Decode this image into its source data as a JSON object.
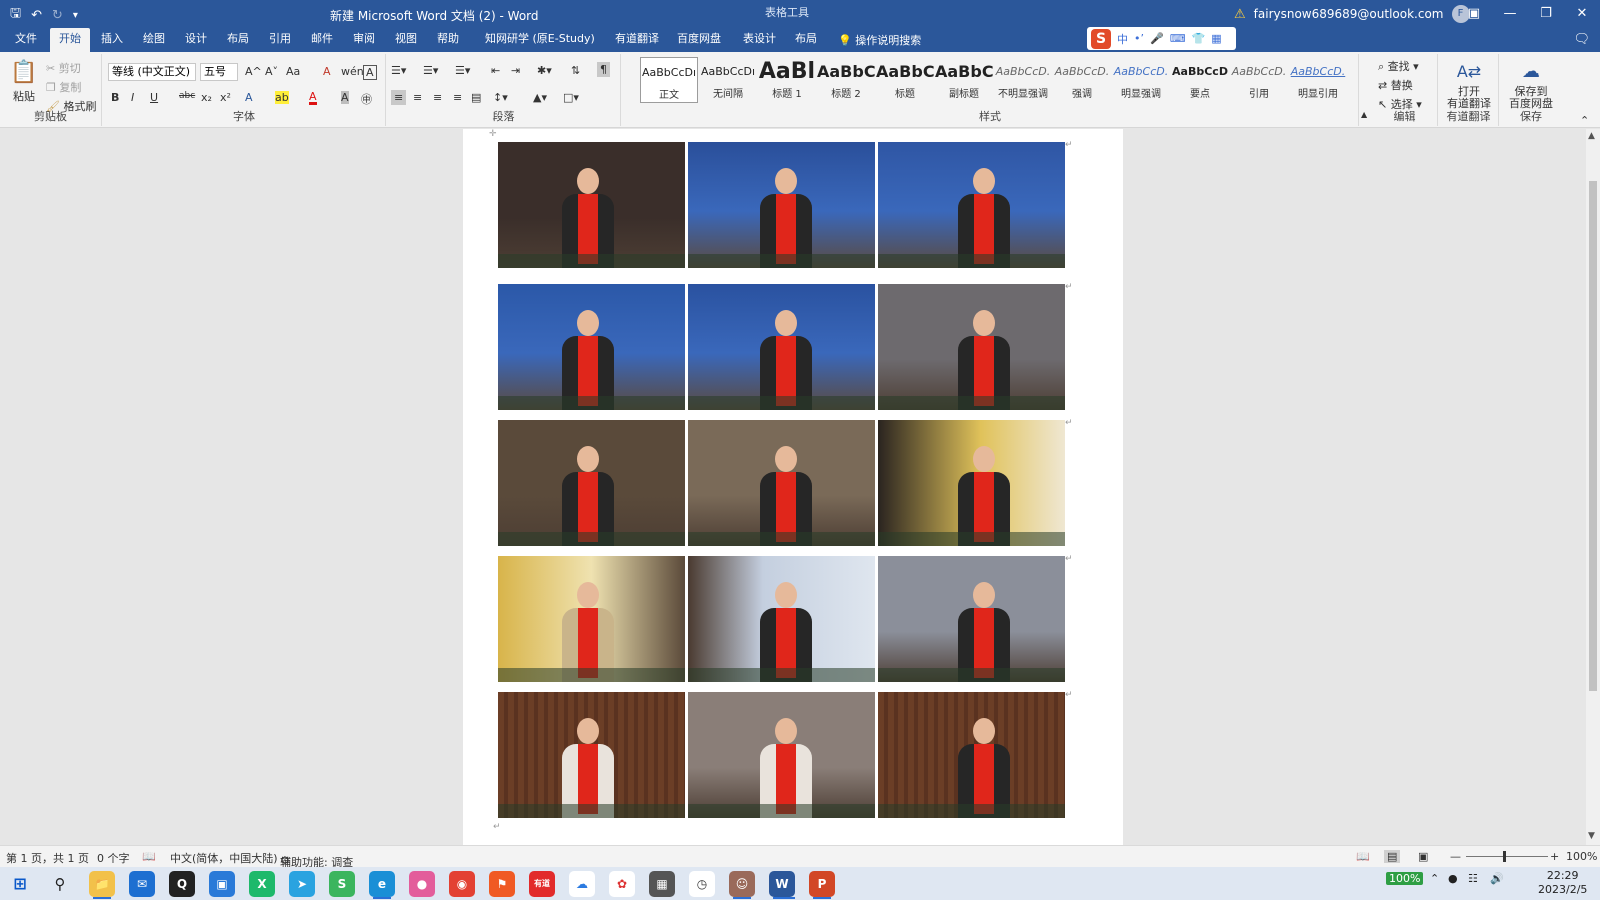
{
  "titlebar": {
    "title": "新建 Microsoft Word 文档 (2)  -  Word",
    "context_tab_group": "表格工具",
    "account": "fairysnow689689@outlook.com",
    "avatar_letter": "F",
    "qat_icons": [
      "save-icon",
      "undo-icon",
      "redo-icon",
      "customize-icon"
    ]
  },
  "tabs": [
    "文件",
    "开始",
    "插入",
    "绘图",
    "设计",
    "布局",
    "引用",
    "邮件",
    "审阅",
    "视图",
    "帮助",
    "知网研学 (原E-Study)",
    "有道翻译",
    "百度网盘",
    "表设计",
    "布局"
  ],
  "active_tab": "开始",
  "tell_me": "操作说明搜索",
  "ime": {
    "mode": "中",
    "brand": "S"
  },
  "ribbon": {
    "clipboard": {
      "paste": "粘贴",
      "cut": "剪切",
      "copy": "复制",
      "format_painter": "格式刷",
      "label": "剪贴板"
    },
    "font": {
      "font_name": "等线 (中文正文)",
      "font_size": "五号",
      "label": "字体",
      "row1": [
        "A^",
        "A˅",
        "Aa",
        "A",
        "wén",
        "A"
      ],
      "row2": [
        "B",
        "I",
        "U",
        "abc",
        "x₂",
        "x²",
        "A",
        "ab",
        "A",
        "A",
        "㊥"
      ]
    },
    "paragraph": {
      "label": "段落"
    },
    "styles": {
      "label": "样式",
      "items": [
        {
          "preview": "AaBbCcDı",
          "name": "正文",
          "size": "11px"
        },
        {
          "preview": "AaBbCcDı",
          "name": "无间隔",
          "size": "11px"
        },
        {
          "preview": "AaBl",
          "name": "标题 1",
          "size": "22px"
        },
        {
          "preview": "AaBbC",
          "name": "标题 2",
          "size": "16px"
        },
        {
          "preview": "AaBbC",
          "name": "标题",
          "size": "16px"
        },
        {
          "preview": "AaBbC",
          "name": "副标题",
          "size": "16px"
        },
        {
          "preview": "AaBbCcD.",
          "name": "不明显强调",
          "size": "11px"
        },
        {
          "preview": "AaBbCcD.",
          "name": "强调",
          "size": "11px"
        },
        {
          "preview": "AaBbCcD.",
          "name": "明显强调",
          "size": "11px"
        },
        {
          "preview": "AaBbCcD",
          "name": "要点",
          "size": "11px"
        },
        {
          "preview": "AaBbCcD.",
          "name": "引用",
          "size": "11px"
        },
        {
          "preview": "AaBbCcD.",
          "name": "明显引用",
          "size": "11px"
        }
      ]
    },
    "editing": {
      "find": "查找",
      "replace": "替换",
      "select": "选择",
      "label": "编辑"
    },
    "youdao": {
      "button": "打开\n有道翻译",
      "label": "有道翻译"
    },
    "baidu": {
      "button": "保存到\n百度网盘",
      "label": "保存"
    }
  },
  "photos": [
    {
      "id": 1,
      "scene": "speaker-dark-room",
      "bg": "#3a2e2a",
      "accent": "#e0261b"
    },
    {
      "id": 2,
      "scene": "ccf-yocsef-backdrop",
      "bg": "#2a4f9a",
      "accent": "#e0261b"
    },
    {
      "id": 3,
      "scene": "ccf-yocsef-backdrop",
      "bg": "#2f56a4",
      "accent": "#e0261b"
    },
    {
      "id": 4,
      "scene": "woman-presenting",
      "bg": "#2b58a8",
      "accent": "#e0261b"
    },
    {
      "id": 5,
      "scene": "ccf-yocsef-backdrop",
      "bg": "#2a52a0",
      "accent": "#e0261b"
    },
    {
      "id": 6,
      "scene": "meeting-room",
      "bg": "#6d6a6e",
      "accent": "#e0261b"
    },
    {
      "id": 7,
      "scene": "man-seated-glasses",
      "bg": "#5a4a3a",
      "accent": "#e0261b"
    },
    {
      "id": 8,
      "scene": "man-standing-window",
      "bg": "#7a6a58",
      "accent": "#e0261b"
    },
    {
      "id": 9,
      "scene": "yellow-window",
      "bg": "#c9b37a",
      "accent": "#e0261b"
    },
    {
      "id": 10,
      "scene": "woman-beige-coat",
      "bg": "#b59a5a",
      "accent": "#e0261b"
    },
    {
      "id": 11,
      "scene": "man-black-coat",
      "bg": "#a9b8cf",
      "accent": "#e0261b"
    },
    {
      "id": 12,
      "scene": "man-standing-table",
      "bg": "#8b8f9a",
      "accent": "#e0261b"
    },
    {
      "id": 13,
      "scene": "woman-wood-wall",
      "bg": "#6b3e26",
      "accent": "#e0261b"
    },
    {
      "id": 14,
      "scene": "woman-speaking",
      "bg": "#8a7e78",
      "accent": "#e0261b"
    },
    {
      "id": 15,
      "scene": "man-standing-wood",
      "bg": "#5e4636",
      "accent": "#e0261b"
    }
  ],
  "status": {
    "page": "第 1 页，共 1 页",
    "words": "0 个字",
    "language": "中文(简体，中国大陆)",
    "accessibility": "辅助功能: 调查",
    "zoom": "100%"
  },
  "taskbar": {
    "battery": "100%",
    "time": "22:29",
    "date": "2023/2/5"
  }
}
